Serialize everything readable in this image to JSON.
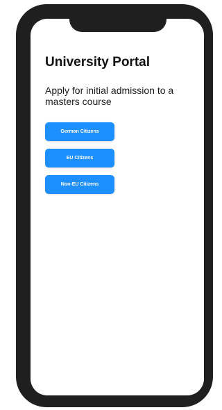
{
  "app": {
    "title": "University Portal",
    "subtitle": "Apply for initial admission to a masters course"
  },
  "options": [
    {
      "label": "German Citizens"
    },
    {
      "label": "EU Citizens"
    },
    {
      "label": "Non-EU Citizens"
    }
  ],
  "colors": {
    "primary": "#1e8fff",
    "frame": "#1f1f1f",
    "screen_background": "#ffffff",
    "title_text": "#111111"
  }
}
